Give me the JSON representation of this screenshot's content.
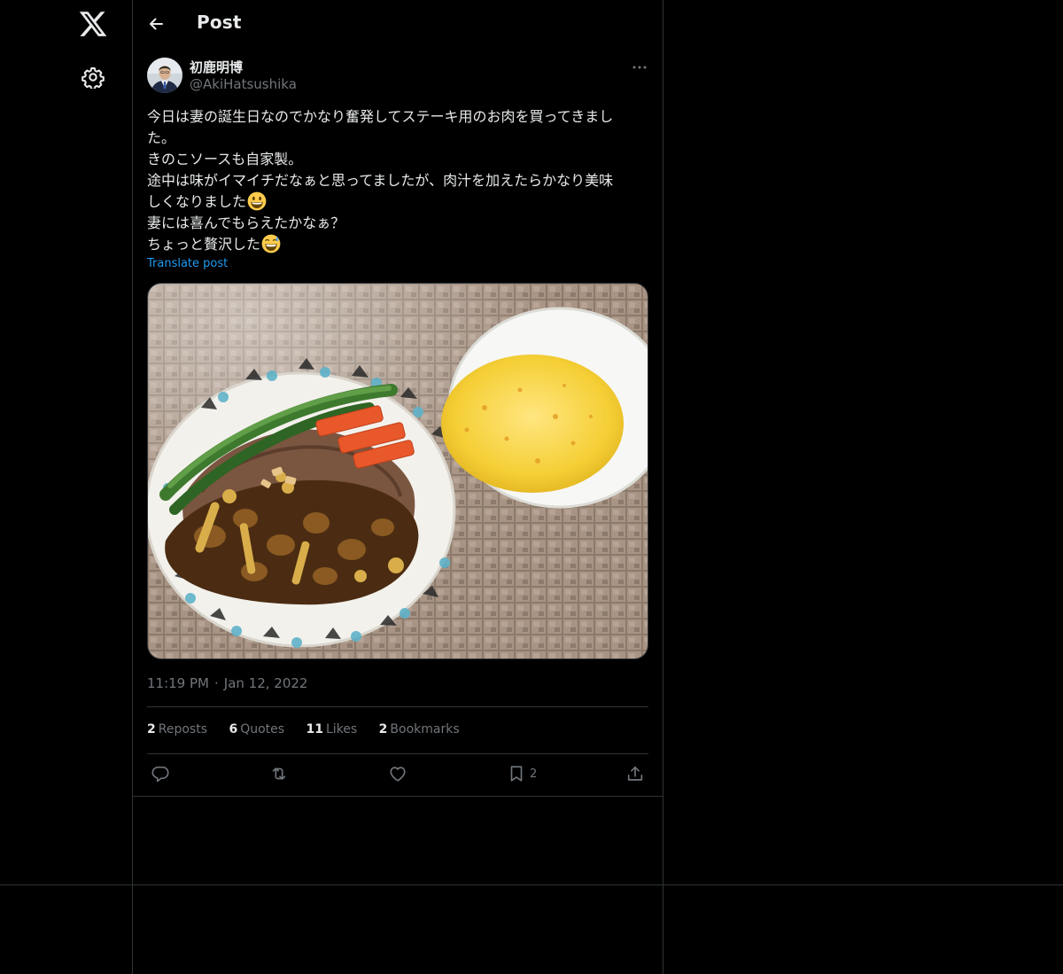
{
  "sidebar": {
    "logo_icon": "x-logo-icon",
    "settings_icon": "gear-icon"
  },
  "header": {
    "title": "Post",
    "back_icon": "arrow-left-icon"
  },
  "post": {
    "author": {
      "display_name": "初鹿明博",
      "handle": "@AkiHatsushika"
    },
    "text_lines": [
      "今日は妻の誕生日なのでかなり奮発してステーキ用のお肉を買ってきまし",
      "た。",
      "きのこソースも自家製。",
      "途中は味がイマイチだなぁと思ってましたが、肉汁を加えたらかなり美味",
      "しくなりました",
      "妻には喜んでもらえたかなぁ？",
      "ちょっと贅沢した"
    ],
    "translate_label": "Translate post",
    "time": "11:19 PM",
    "separator": "·",
    "date": "Jan 12, 2022",
    "stats": {
      "reposts_count": "2",
      "reposts_label": "Reposts",
      "quotes_count": "6",
      "quotes_label": "Quotes",
      "likes_count": "11",
      "likes_label": "Likes",
      "bookmarks_count": "2",
      "bookmarks_label": "Bookmarks"
    },
    "actions": {
      "bookmark_count": "2"
    }
  },
  "colors": {
    "background": "#000000",
    "text": "#e7e9ea",
    "muted": "#71767b",
    "accent": "#1d9bf0",
    "border": "#2f3336"
  }
}
